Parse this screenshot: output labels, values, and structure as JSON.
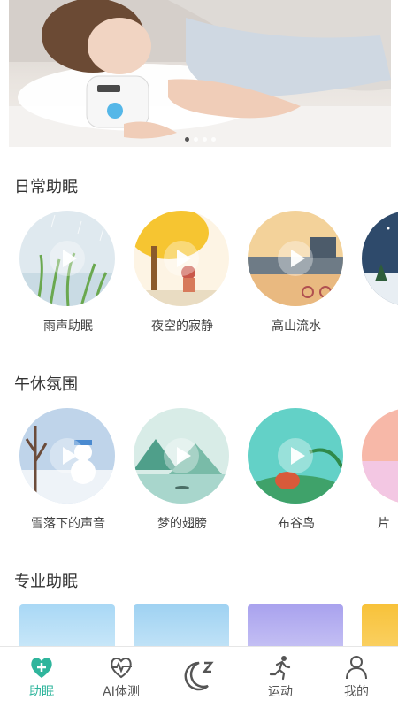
{
  "banner": {
    "dots": 4,
    "active_dot": 1
  },
  "sections": [
    {
      "title": "日常助眠",
      "items": [
        {
          "label": "雨声助眠"
        },
        {
          "label": "夜空的寂静"
        },
        {
          "label": "高山流水"
        }
      ]
    },
    {
      "title": "午休氛围",
      "items": [
        {
          "label": "雪落下的声音"
        },
        {
          "label": "梦的翅膀"
        },
        {
          "label": "布谷鸟"
        },
        {
          "label": "片"
        }
      ]
    },
    {
      "title": "专业助眠"
    }
  ],
  "tabbar": [
    {
      "label": "助眠",
      "icon": "heart-plus-icon",
      "active": true
    },
    {
      "label": "AI体测",
      "icon": "heartbeat-icon"
    },
    {
      "label": "",
      "icon": "moon-sleep-icon"
    },
    {
      "label": "运动",
      "icon": "running-icon"
    },
    {
      "label": "我的",
      "icon": "person-icon"
    }
  ],
  "colors": {
    "accent": "#2fb59c"
  }
}
